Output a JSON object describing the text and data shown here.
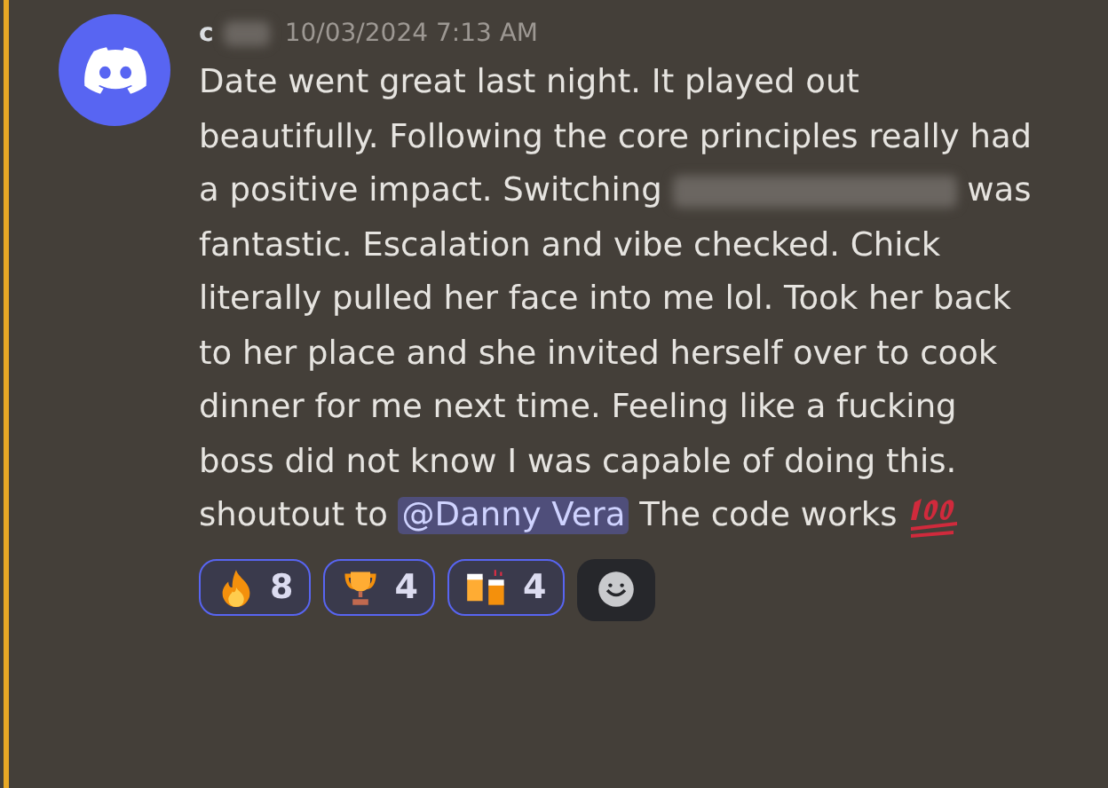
{
  "message": {
    "author": "c",
    "author_redacted": true,
    "timestamp": "10/03/2024 7:13 AM",
    "mentions_me": true,
    "content": [
      {
        "kind": "text",
        "text": "Date went great last night. It played out beautifully. Following the core principles really had a positive impact. Switching"
      },
      {
        "kind": "redacted"
      },
      {
        "kind": "text",
        "text": "was fantastic. Escalation and vibe checked. Chick literally pulled her face into me lol. Took her back to her place and she invited herself over to cook dinner for me next time. Feeling like a fucking boss did not know I was capable of doing this. shoutout to"
      },
      {
        "kind": "mention",
        "text": "@Danny Vera"
      },
      {
        "kind": "text",
        "text": "The code works"
      },
      {
        "kind": "emoji100"
      }
    ],
    "reactions": [
      {
        "kind": "fire",
        "count": "8",
        "selected": true
      },
      {
        "kind": "trophy",
        "count": "4",
        "selected": true
      },
      {
        "kind": "beers",
        "count": "4",
        "selected": true
      }
    ]
  }
}
